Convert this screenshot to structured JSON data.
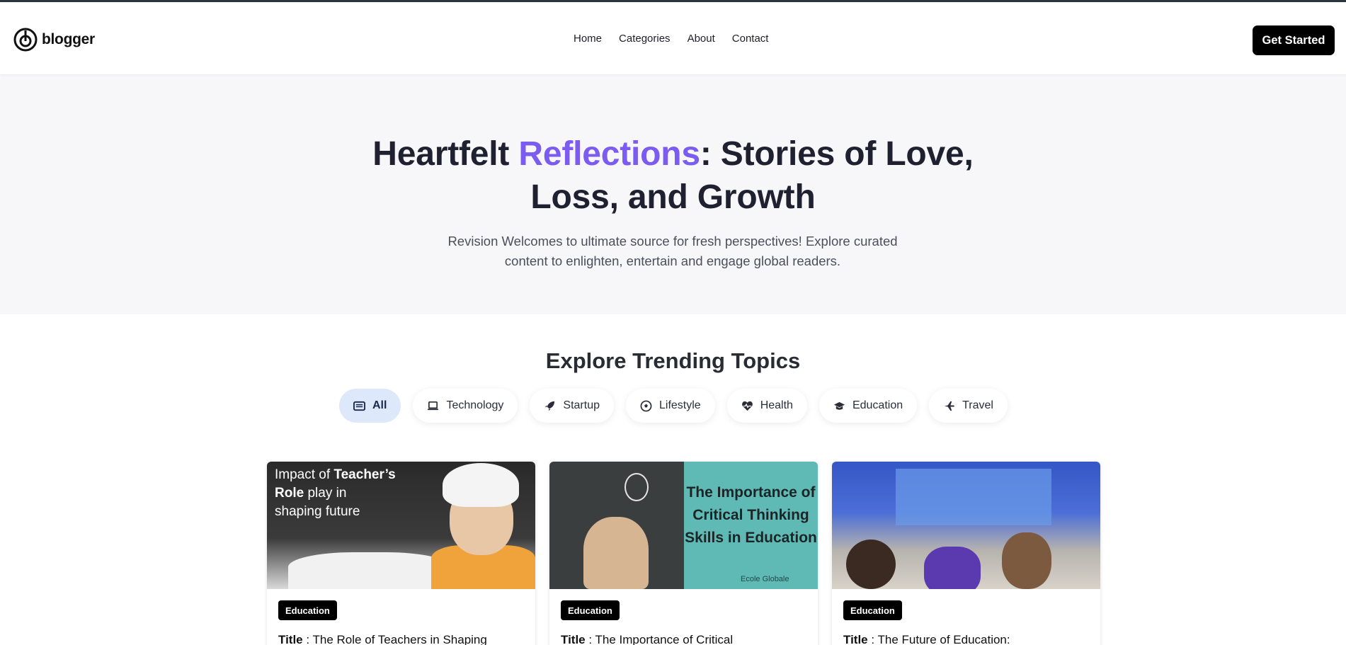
{
  "brand": {
    "name": "blogger",
    "icon": "blogger-logo-icon"
  },
  "nav": {
    "items": [
      "Home",
      "Categories",
      "About",
      "Contact"
    ]
  },
  "header": {
    "cta_label": "Get Started"
  },
  "hero": {
    "title_part1": "Heartfelt ",
    "title_accent": "Reflections",
    "title_part2": ": Stories of Love, Loss, and Growth",
    "subtitle": "Revision Welcomes to ultimate source for fresh perspectives! Explore curated content to enlighten, entertain and engage global readers.",
    "accent_color": "#7c5cf0"
  },
  "topics": {
    "title": "Explore Trending Topics",
    "chips": [
      {
        "label": "All",
        "icon": "newspaper-icon",
        "active": true
      },
      {
        "label": "Technology",
        "icon": "laptop-icon",
        "active": false
      },
      {
        "label": "Startup",
        "icon": "rocket-icon",
        "active": false
      },
      {
        "label": "Lifestyle",
        "icon": "soccer-ball-icon",
        "active": false
      },
      {
        "label": "Health",
        "icon": "heart-pulse-icon",
        "active": false
      },
      {
        "label": "Education",
        "icon": "graduation-cap-icon",
        "active": false
      },
      {
        "label": "Travel",
        "icon": "plane-icon",
        "active": false
      }
    ]
  },
  "cards": [
    {
      "category": "Education",
      "title_prefix": "Title",
      "title": " : The Role of Teachers in Shaping",
      "image_text_1": "Impact of ",
      "image_text_bold_1": "Teacher’s",
      "image_text_bold_2": "Role",
      "image_text_2": " play in",
      "image_text_3": "shaping future"
    },
    {
      "category": "Education",
      "title_prefix": "Title",
      "title": " : The Importance of Critical",
      "image_text": "The Importance of Critical Thinking Skills in Education",
      "image_brand": "Ecole Globale"
    },
    {
      "category": "Education",
      "title_prefix": "Title",
      "title": " : The Future of Education:"
    }
  ]
}
